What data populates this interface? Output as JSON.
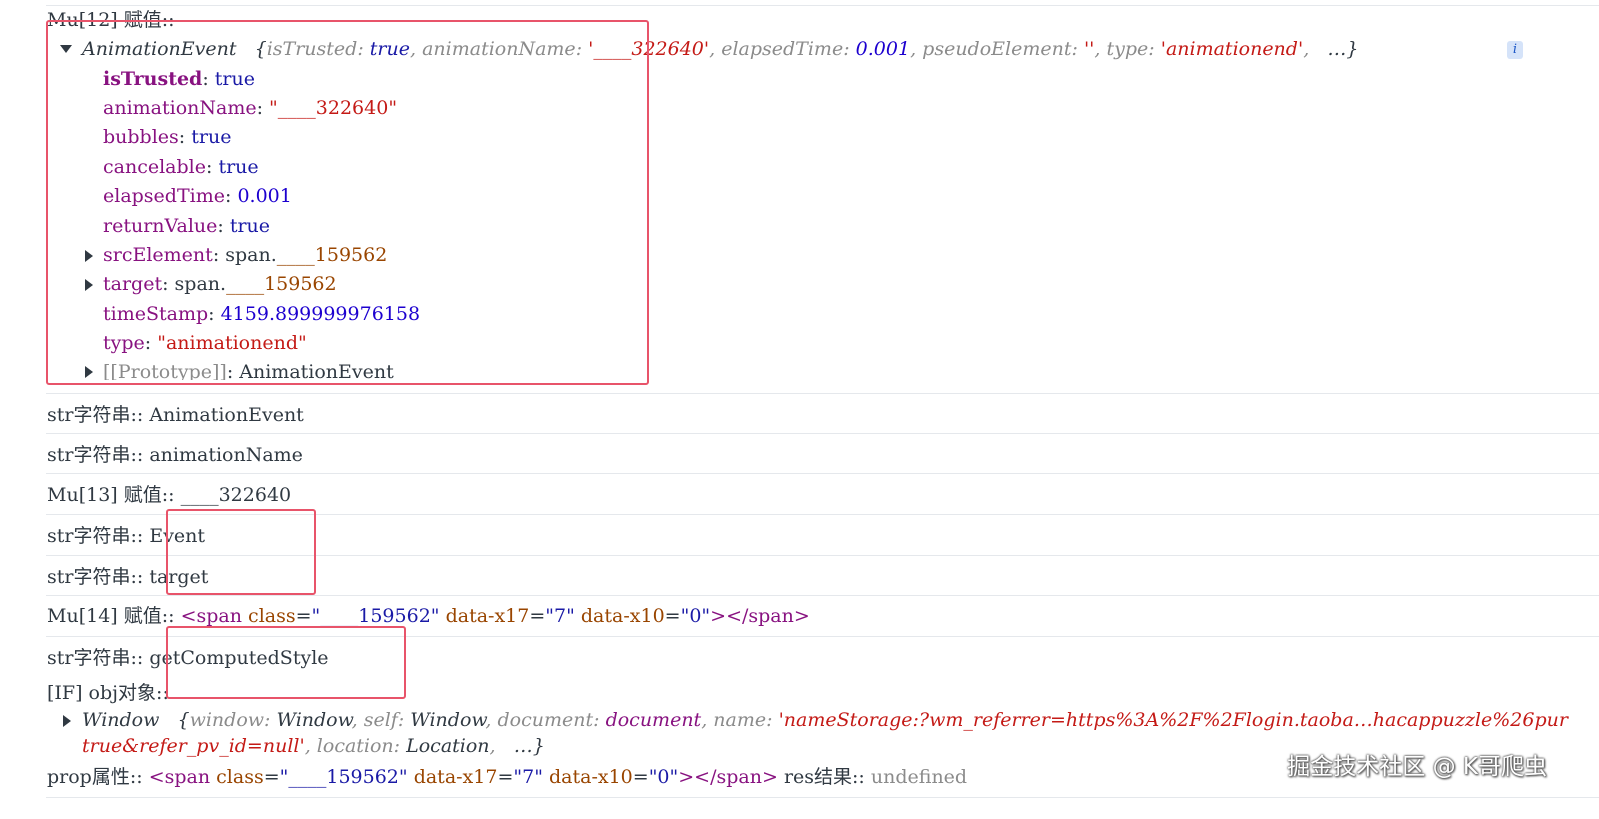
{
  "logs": {
    "mu12_label": "Mu[12] 赋值::",
    "event_summary": {
      "class_name": "AnimationEvent",
      "open_brace": "{",
      "k_isTrusted": "isTrusted",
      "v_isTrusted": "true",
      "k_animationName": "animationName",
      "v_animationName": "'____322640'",
      "k_elapsedTime": "elapsedTime",
      "v_elapsedTime": "0.001",
      "k_pseudoElement": "pseudoElement",
      "v_pseudoElement": "''",
      "k_type": "type",
      "v_type": "'animationend'",
      "ellipsis": "…}",
      "info_icon_glyph": "i"
    },
    "event_props": [
      {
        "key": "isTrusted",
        "value": "true"
      },
      {
        "key": "animationName",
        "value": "\"____322640\""
      },
      {
        "key": "bubbles",
        "value": "true"
      },
      {
        "key": "cancelable",
        "value": "true"
      },
      {
        "key": "elapsedTime",
        "value": "0.001"
      },
      {
        "key": "returnValue",
        "value": "true"
      },
      {
        "key": "srcElement",
        "value_prefix": "span.",
        "value": "____159562"
      },
      {
        "key": "target",
        "value_prefix": "span.",
        "value": "____159562"
      },
      {
        "key": "timeStamp",
        "value": "4159.899999976158"
      },
      {
        "key": "type",
        "value": "\"animationend\""
      },
      {
        "key": "[[Prototype]]",
        "value": "AnimationEvent"
      }
    ],
    "str1": {
      "label": "str字符串::",
      "value": "AnimationEvent"
    },
    "str2": {
      "label": "str字符串::",
      "value": "animationName"
    },
    "mu13": {
      "label": "Mu[13] 赋值::",
      "value": "____322640"
    },
    "str3": {
      "label": "str字符串::",
      "value": "Event"
    },
    "str4": {
      "label": "str字符串::",
      "value": "target"
    },
    "mu14": {
      "label": "Mu[14] 赋值::",
      "open_tag": "<span",
      "a1_name": "class",
      "a1_value": "\"____159562\"",
      "a2_name": "data-x17",
      "a2_value": "\"7\"",
      "a3_name": "data-x10",
      "a3_value": "\"0\"",
      "close_tag": "></span>"
    },
    "str5": {
      "label": "str字符串::",
      "value": "getComputedStyle"
    },
    "if_obj": {
      "label": "[IF] obj对象::"
    },
    "window_summary": {
      "class_name": "Window",
      "k_window": "window",
      "v_window": "Window",
      "k_self": "self",
      "v_self": "Window",
      "k_document": "document",
      "v_document": "document",
      "k_name": "name",
      "v_name_line1": "'nameStorage:?wm_referrer=https%3A%2F%2Flogin.taoba…hacappuzzle%26pur",
      "v_name_line2": "true&refer_pv_id=null'",
      "k_location": "location",
      "v_location": "Location",
      "ellipsis": "…}"
    },
    "prop": {
      "label": "prop属性::",
      "open_tag": "<span",
      "a1_name": "class",
      "a1_value": "\"____159562\"",
      "a2_name": "data-x17",
      "a2_value": "\"7\"",
      "a3_name": "data-x10",
      "a3_value": "\"0\"",
      "close_tag": "></span>",
      "res_label": "res结果::",
      "res_value": "undefined"
    }
  },
  "watermark": "掘金技术社区 @ K哥爬虫",
  "colors": {
    "highlight": "#e8546a",
    "key": "#881280",
    "string": "#c41a16",
    "number": "#1c00cf"
  }
}
